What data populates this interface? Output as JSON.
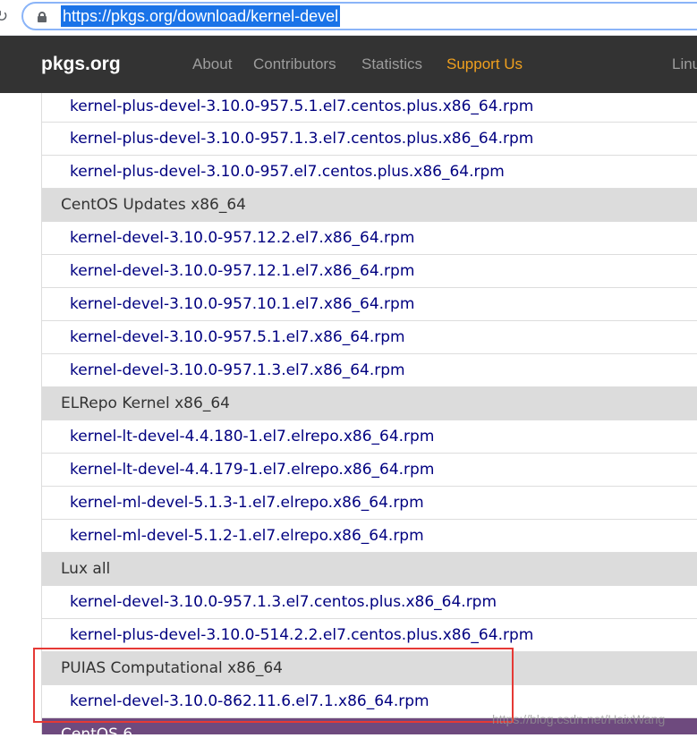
{
  "browser": {
    "reload_glyph": "↻",
    "url": "https://pkgs.org/download/kernel-devel"
  },
  "nav": {
    "brand": "pkgs.org",
    "links": [
      "About",
      "Contributors",
      "Statistics",
      "Support Us",
      "Linu"
    ]
  },
  "list": {
    "rows": [
      {
        "type": "file",
        "text": "kernel-plus-devel-3.10.0-957.5.1.el7.centos.plus.x86_64.rpm"
      },
      {
        "type": "file",
        "text": "kernel-plus-devel-3.10.0-957.1.3.el7.centos.plus.x86_64.rpm"
      },
      {
        "type": "file",
        "text": "kernel-plus-devel-3.10.0-957.el7.centos.plus.x86_64.rpm"
      },
      {
        "type": "group",
        "text": "CentOS Updates x86_64"
      },
      {
        "type": "file",
        "text": "kernel-devel-3.10.0-957.12.2.el7.x86_64.rpm"
      },
      {
        "type": "file",
        "text": "kernel-devel-3.10.0-957.12.1.el7.x86_64.rpm"
      },
      {
        "type": "file",
        "text": "kernel-devel-3.10.0-957.10.1.el7.x86_64.rpm"
      },
      {
        "type": "file",
        "text": "kernel-devel-3.10.0-957.5.1.el7.x86_64.rpm"
      },
      {
        "type": "file",
        "text": "kernel-devel-3.10.0-957.1.3.el7.x86_64.rpm"
      },
      {
        "type": "group",
        "text": "ELRepo Kernel x86_64"
      },
      {
        "type": "file",
        "text": "kernel-lt-devel-4.4.180-1.el7.elrepo.x86_64.rpm"
      },
      {
        "type": "file",
        "text": "kernel-lt-devel-4.4.179-1.el7.elrepo.x86_64.rpm"
      },
      {
        "type": "file",
        "text": "kernel-ml-devel-5.1.3-1.el7.elrepo.x86_64.rpm"
      },
      {
        "type": "file",
        "text": "kernel-ml-devel-5.1.2-1.el7.elrepo.x86_64.rpm"
      },
      {
        "type": "group",
        "text": "Lux all"
      },
      {
        "type": "file",
        "text": "kernel-devel-3.10.0-957.1.3.el7.centos.plus.x86_64.rpm"
      },
      {
        "type": "file",
        "text": "kernel-plus-devel-3.10.0-514.2.2.el7.centos.plus.x86_64.rpm"
      },
      {
        "type": "group",
        "text": "PUIAS Computational x86_64"
      },
      {
        "type": "file",
        "text": "kernel-devel-3.10.0-862.11.6.el7.1.x86_64.rpm"
      },
      {
        "type": "partial",
        "text": "CentOS 6"
      }
    ]
  },
  "watermark": "https://blog.csdn.net/HaixWang"
}
